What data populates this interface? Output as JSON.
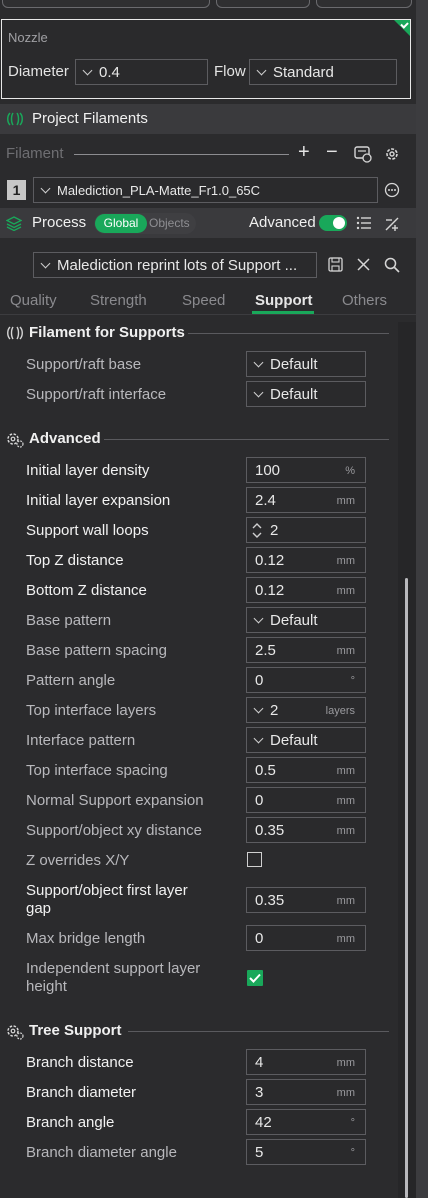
{
  "nozzle": {
    "title": "Nozzle",
    "diameter_label": "Diameter",
    "diameter_value": "0.4",
    "flow_label": "Flow",
    "flow_value": "Standard"
  },
  "project_filaments": {
    "title": "Project Filaments"
  },
  "filament_toolbar": {
    "label": "Filament",
    "add": "+",
    "remove": "−"
  },
  "filament_row": {
    "index": "1",
    "name": "Malediction_PLA-Matte_Fr1.0_65C"
  },
  "process": {
    "title": "Process",
    "global_label": "Global",
    "objects_label": "Objects",
    "advanced_label": "Advanced",
    "advanced_on": true
  },
  "preset": {
    "name": "Malediction reprint lots of Support ..."
  },
  "tabs": [
    "Quality",
    "Strength",
    "Speed",
    "Support",
    "Others"
  ],
  "active_tab": "Support",
  "sections": {
    "filament_for_supports": "Filament for Supports",
    "advanced": "Advanced",
    "tree_support": "Tree Support"
  },
  "filament_support_rows": [
    {
      "label": "Support/raft base",
      "value": "Default"
    },
    {
      "label": "Support/raft interface",
      "value": "Default"
    }
  ],
  "advanced_rows": [
    {
      "label": "Initial layer density",
      "value": "100",
      "unit": "%"
    },
    {
      "label": "Initial layer expansion",
      "value": "2.4",
      "unit": "mm"
    },
    {
      "label": "Support wall loops",
      "value": "2",
      "unit": ""
    },
    {
      "label": "Top Z distance",
      "value": "0.12",
      "unit": "mm"
    },
    {
      "label": "Bottom Z distance",
      "value": "0.12",
      "unit": "mm"
    },
    {
      "label": "Base pattern",
      "value": "Default",
      "unit": ""
    },
    {
      "label": "Base pattern spacing",
      "value": "2.5",
      "unit": "mm"
    },
    {
      "label": "Pattern angle",
      "value": "0",
      "unit": "°"
    },
    {
      "label": "Top interface layers",
      "value": "2",
      "unit": "layers"
    },
    {
      "label": "Interface pattern",
      "value": "Default",
      "unit": ""
    },
    {
      "label": "Top interface spacing",
      "value": "0.5",
      "unit": "mm"
    },
    {
      "label": "Normal Support expansion",
      "value": "0",
      "unit": "mm"
    },
    {
      "label": "Support/object xy distance",
      "value": "0.35",
      "unit": "mm"
    },
    {
      "label": "Z overrides X/Y",
      "value": "",
      "unit": ""
    },
    {
      "label": "Support/object first layer",
      "label2": "gap",
      "value": "0.35",
      "unit": "mm"
    },
    {
      "label": "Max bridge length",
      "value": "0",
      "unit": "mm"
    },
    {
      "label": "Independent support layer",
      "label2": "height",
      "value": "",
      "unit": ""
    }
  ],
  "tree_rows": [
    {
      "label": "Branch distance",
      "value": "4",
      "unit": "mm"
    },
    {
      "label": "Branch diameter",
      "value": "3",
      "unit": "mm"
    },
    {
      "label": "Branch angle",
      "value": "42",
      "unit": "°"
    },
    {
      "label": "Branch diameter angle",
      "value": "5",
      "unit": "°"
    }
  ],
  "checkboxes": {
    "z_overrides_xy": false,
    "independent_support_layer_height": true
  },
  "colors": {
    "accent": "#19a85a",
    "panel": "#2b2b2d",
    "header": "#3a3a3d"
  }
}
